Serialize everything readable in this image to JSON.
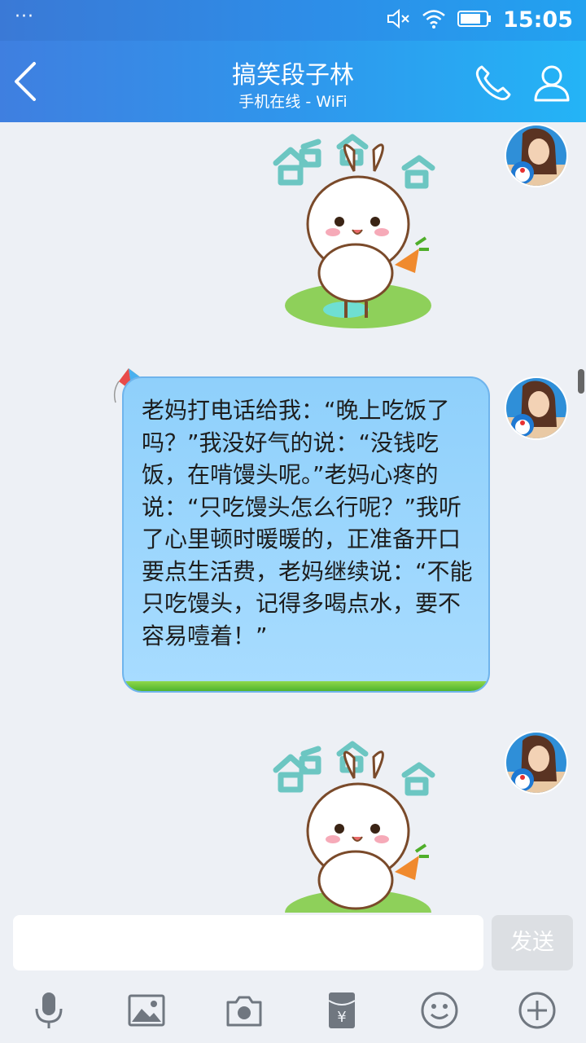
{
  "status_bar": {
    "more": "···",
    "time": "15:05",
    "icons": [
      "mute-icon",
      "wifi-icon",
      "battery-icon"
    ]
  },
  "header": {
    "title": "搞笑段子林",
    "subtitle": "手机在线 - WiFi",
    "icons": [
      "back-icon",
      "phone-icon",
      "profile-icon"
    ]
  },
  "messages": [
    {
      "type": "sticker",
      "sticker_name": "rabbit-haha-sticker",
      "text": "哈哈哈"
    },
    {
      "type": "text",
      "text": "老妈打电话给我：“晚上吃饭了吗？”我没好气的说：“没钱吃饭，在啃馒头呢。”老妈心疼的说：“只吃馒头怎么行呢？”我听了心里顿时暖暖的，正准备开口要点生活费，老妈继续说：“不能只吃馒头，记得多喝点水，要不容易噎着！”"
    },
    {
      "type": "sticker",
      "sticker_name": "rabbit-haha-sticker",
      "text": "哈哈哈"
    }
  ],
  "input": {
    "value": "",
    "placeholder": "",
    "send_label": "发送"
  },
  "toolbar": {
    "icons": [
      "microphone-icon",
      "image-icon",
      "camera-icon",
      "red-packet-icon",
      "emoji-icon",
      "plus-icon"
    ]
  },
  "colors": {
    "header_start": "#3f7fe0",
    "header_end": "#24b4f6",
    "bubble": "#a8dcff",
    "background": "#edf0f5"
  }
}
